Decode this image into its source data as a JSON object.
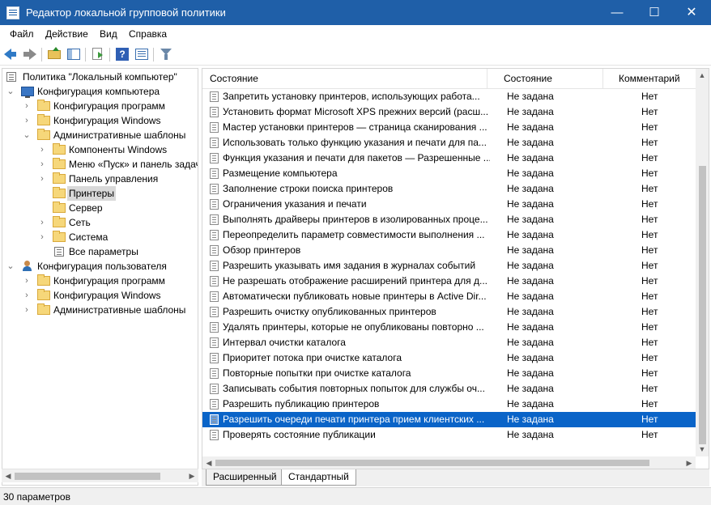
{
  "window": {
    "title": "Редактор локальной групповой политики",
    "controls": {
      "minimize": "—",
      "maximize": "☐",
      "close": "✕"
    }
  },
  "menu": [
    "Файл",
    "Действие",
    "Вид",
    "Справка"
  ],
  "toolbar": {
    "icons": [
      "back-icon",
      "forward-icon",
      "up-folder-icon",
      "show-hide-tree-icon",
      "export-list-icon",
      "help-icon",
      "properties-icon",
      "filter-icon"
    ],
    "help_glyph": "?"
  },
  "tree": {
    "root": "Политика \"Локальный компьютер\"",
    "computer_config": "Конфигурация компьютера",
    "cc_programs": "Конфигурация программ",
    "cc_windows": "Конфигурация Windows",
    "cc_admin": "Административные шаблоны",
    "at_components": "Компоненты Windows",
    "at_start": "Меню «Пуск» и панель задач",
    "at_control": "Панель управления",
    "at_printers": "Принтеры",
    "at_server": "Сервер",
    "at_network": "Сеть",
    "at_system": "Система",
    "at_all": "Все параметры",
    "user_config": "Конфигурация пользователя",
    "uc_programs": "Конфигурация программ",
    "uc_windows": "Конфигурация Windows",
    "uc_admin": "Административные шаблоны",
    "chevron_open": "⌄",
    "chevron_closed": "›"
  },
  "list": {
    "headers": {
      "name": "Состояние",
      "state": "Состояние",
      "comment": "Комментарий"
    },
    "rows": [
      {
        "name": "Запретить установку принтеров, использующих работа...",
        "state": "Не задана",
        "comment": "Нет"
      },
      {
        "name": "Установить формат Microsoft XPS прежних версий (расш...",
        "state": "Не задана",
        "comment": "Нет"
      },
      {
        "name": "Мастер установки принтеров — страница сканирования ...",
        "state": "Не задана",
        "comment": "Нет"
      },
      {
        "name": "Использовать только функцию указания и печати для па...",
        "state": "Не задана",
        "comment": "Нет"
      },
      {
        "name": "Функция указания и печати для пакетов — Разрешенные ...",
        "state": "Не задана",
        "comment": "Нет"
      },
      {
        "name": "Размещение компьютера",
        "state": "Не задана",
        "comment": "Нет"
      },
      {
        "name": "Заполнение строки поиска принтеров",
        "state": "Не задана",
        "comment": "Нет"
      },
      {
        "name": "Ограничения указания и печати",
        "state": "Не задана",
        "comment": "Нет"
      },
      {
        "name": "Выполнять драйверы принтеров в изолированных проце...",
        "state": "Не задана",
        "comment": "Нет"
      },
      {
        "name": "Переопределить параметр совместимости выполнения ...",
        "state": "Не задана",
        "comment": "Нет"
      },
      {
        "name": "Обзор принтеров",
        "state": "Не задана",
        "comment": "Нет"
      },
      {
        "name": "Разрешить указывать имя задания в журналах событий",
        "state": "Не задана",
        "comment": "Нет"
      },
      {
        "name": "Не разрешать отображение расширений принтера для д...",
        "state": "Не задана",
        "comment": "Нет"
      },
      {
        "name": "Автоматически публиковать новые принтеры в Active Dir...",
        "state": "Не задана",
        "comment": "Нет"
      },
      {
        "name": "Разрешить очистку опубликованных принтеров",
        "state": "Не задана",
        "comment": "Нет"
      },
      {
        "name": "Удалять принтеры, которые не опубликованы повторно ...",
        "state": "Не задана",
        "comment": "Нет"
      },
      {
        "name": "Интервал очистки каталога",
        "state": "Не задана",
        "comment": "Нет"
      },
      {
        "name": "Приоритет потока при очистке каталога",
        "state": "Не задана",
        "comment": "Нет"
      },
      {
        "name": "Повторные попытки при очистке каталога",
        "state": "Не задана",
        "comment": "Нет"
      },
      {
        "name": "Записывать события повторных попыток для службы оч...",
        "state": "Не задана",
        "comment": "Нет"
      },
      {
        "name": "Разрешить публикацию принтеров",
        "state": "Не задана",
        "comment": "Нет"
      },
      {
        "name": "Разрешить очереди печати принтера прием клиентских ...",
        "state": "Не задана",
        "comment": "Нет"
      },
      {
        "name": "Проверять состояние публикации",
        "state": "Не задана",
        "comment": "Нет"
      }
    ],
    "selected_index": 21
  },
  "tabs": [
    "Расширенный",
    "Стандартный"
  ],
  "status": "30 параметров",
  "colors": {
    "titlebar": "#1f5fa8",
    "selection": "#0a64c8"
  }
}
